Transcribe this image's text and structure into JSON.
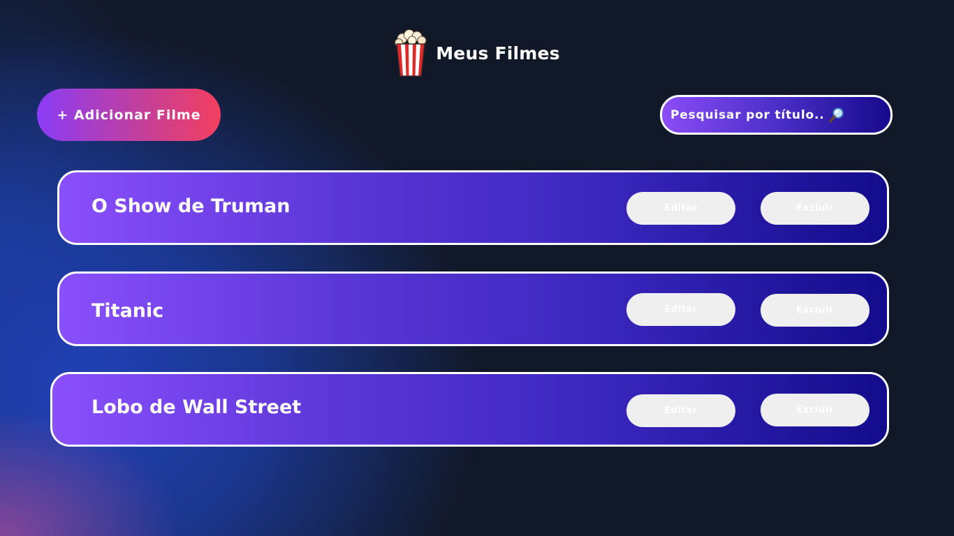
{
  "header": {
    "title": "Meus Filmes",
    "icon": "popcorn-icon"
  },
  "toolbar": {
    "add_label": "+ Adicionar Filme",
    "search_placeholder": "Pesquisar por título..",
    "search_icon": "magnifying-glass-icon"
  },
  "movies": [
    {
      "title": "O Show de Truman",
      "edit_label": "Editar",
      "delete_label": "Excluir"
    },
    {
      "title": "Titanic",
      "edit_label": "Editar",
      "delete_label": "Excluir"
    },
    {
      "title": "Lobo de Wall Street",
      "edit_label": "Editar",
      "delete_label": "Excluir"
    }
  ],
  "colors": {
    "background": "#111827",
    "accent_pink": "#f43f5e",
    "accent_purple": "#8b3cf6",
    "card_start": "#8a4ffc",
    "card_end": "#120c8c",
    "glow_blue": "#1e40af"
  }
}
